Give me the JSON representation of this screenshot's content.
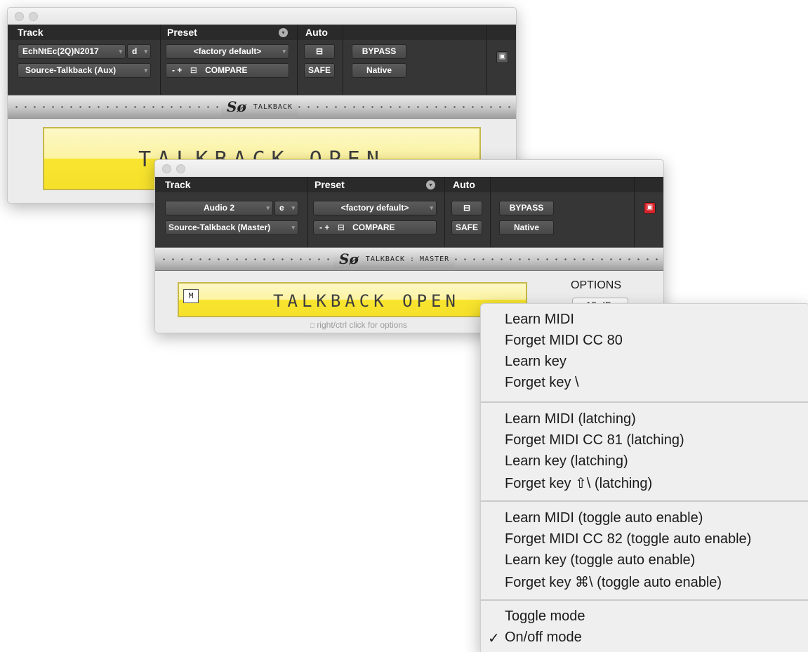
{
  "back_window": {
    "headers": {
      "track": "Track",
      "preset": "Preset",
      "auto": "Auto"
    },
    "track_name": "EchNtEc(2Q)N2017",
    "track_letter": "d",
    "insert_name": "Source-Talkback (Aux)",
    "preset_value": "<factory default>",
    "preset_controls": "-  +",
    "compare": "COMPARE",
    "bypass": "BYPASS",
    "safe": "SAFE",
    "native": "Native",
    "banner_logo": "Sø",
    "banner_name": "TALKBACK",
    "talkback_text": "TALKBACK OPEN"
  },
  "front_window": {
    "headers": {
      "track": "Track",
      "preset": "Preset",
      "auto": "Auto"
    },
    "track_name": "Audio 2",
    "track_letter": "e",
    "insert_name": "Source-Talkback (Master)",
    "preset_value": "<factory default>",
    "preset_controls": "-  +",
    "compare": "COMPARE",
    "bypass": "BYPASS",
    "safe": "SAFE",
    "native": "Native",
    "banner_logo": "Sø",
    "banner_name": "TALKBACK : MASTER",
    "mode_indicator": "M",
    "talkback_text": "TALKBACK OPEN",
    "options_label": "OPTIONS",
    "gain_value": "-15 dB",
    "hint_text": "right/ctrl click for options"
  },
  "context_menu": {
    "group1": [
      "Learn MIDI",
      "Forget MIDI CC 80",
      "Learn key",
      "Forget key \\"
    ],
    "group2": [
      "Learn MIDI (latching)",
      "Forget MIDI CC 81 (latching)",
      "Learn key (latching)",
      "Forget key ⇧\\ (latching)"
    ],
    "group3": [
      "Learn MIDI (toggle auto enable)",
      "Forget MIDI CC 82 (toggle auto enable)",
      "Learn key (toggle auto enable)",
      "Forget key ⌘\\ (toggle auto enable)"
    ],
    "group4": [
      "Toggle mode",
      "On/off mode"
    ],
    "checkmark": "✓"
  },
  "colors": {
    "header_bg": "#363636",
    "talkback_yellow": "#f6e12a",
    "power_active": "#d8232a",
    "menu_bg": "#efefef"
  },
  "icons": [
    "link-icon",
    "power-icon",
    "mouse-icon",
    "chevron-down-icon",
    "check-icon"
  ]
}
